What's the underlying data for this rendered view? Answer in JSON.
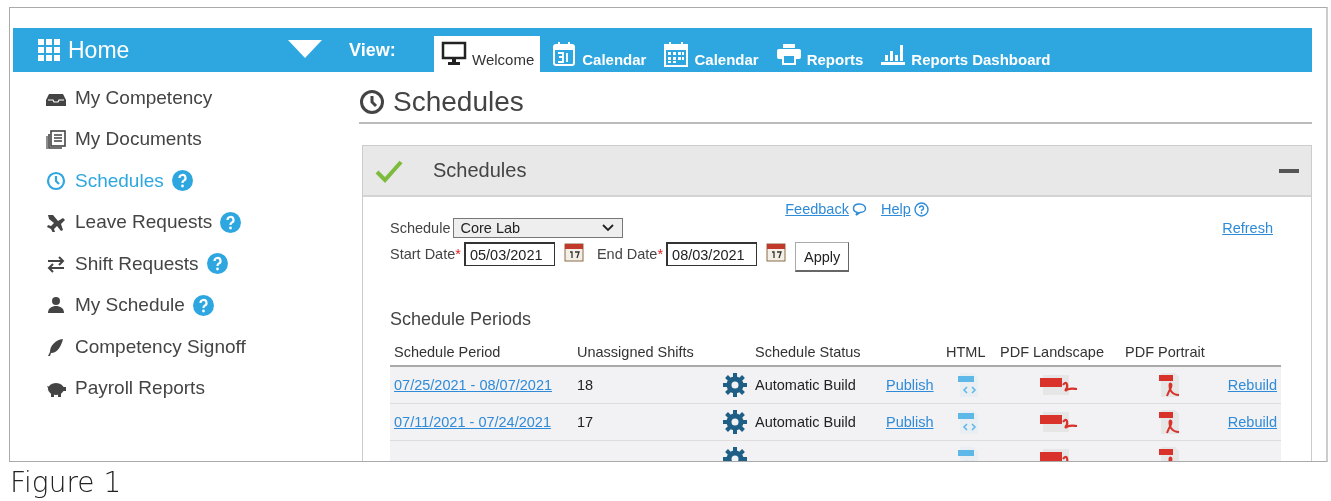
{
  "topbar": {
    "title": "Home",
    "view_label": "View:"
  },
  "tabs": [
    {
      "label": "Welcome",
      "selected": true
    },
    {
      "label": "Calendar",
      "selected": false
    },
    {
      "label": "Calendar",
      "selected": false
    },
    {
      "label": "Reports",
      "selected": false
    },
    {
      "label": "Reports Dashboard",
      "selected": false
    }
  ],
  "sidebar": {
    "items": [
      {
        "label": "My Competency",
        "selected": false,
        "help": false
      },
      {
        "label": "My Documents",
        "selected": false,
        "help": false
      },
      {
        "label": "Schedules",
        "selected": true,
        "help": true
      },
      {
        "label": "Leave Requests",
        "selected": false,
        "help": true
      },
      {
        "label": "Shift Requests",
        "selected": false,
        "help": true
      },
      {
        "label": "My Schedule",
        "selected": false,
        "help": true
      },
      {
        "label": "Competency Signoff",
        "selected": false,
        "help": false
      },
      {
        "label": "Payroll Reports",
        "selected": false,
        "help": false
      }
    ]
  },
  "page_title": "Schedules",
  "panel": {
    "title": "Schedules",
    "links": [
      "Feedback",
      "Help"
    ],
    "refresh": "Refresh",
    "schedule_label": "Schedule",
    "schedule_value": "Core Lab",
    "required_mark": "*",
    "start_label": "Start Date",
    "start_value": "05/03/2021",
    "end_label": "End Date",
    "end_value": "08/03/2021",
    "apply": "Apply",
    "section_title": "Schedule Periods",
    "table": {
      "columns": [
        "Schedule Period",
        "Unassigned Shifts",
        "Schedule Status",
        "HTML",
        "PDF Landscape",
        "PDF Portrait"
      ],
      "rows": [
        {
          "kind": "full",
          "period": "07/25/2021 - 08/07/2021",
          "unassigned": "18",
          "status": "Automatic Build",
          "publish": "Publish",
          "rebuild": "Rebuild"
        },
        {
          "kind": "full",
          "period": "07/11/2021 - 07/24/2021",
          "unassigned": "17",
          "status": "Automatic Build",
          "publish": "Publish",
          "rebuild": "Rebuild"
        },
        {
          "kind": "cut"
        }
      ]
    }
  },
  "caption": "Figure 1"
}
